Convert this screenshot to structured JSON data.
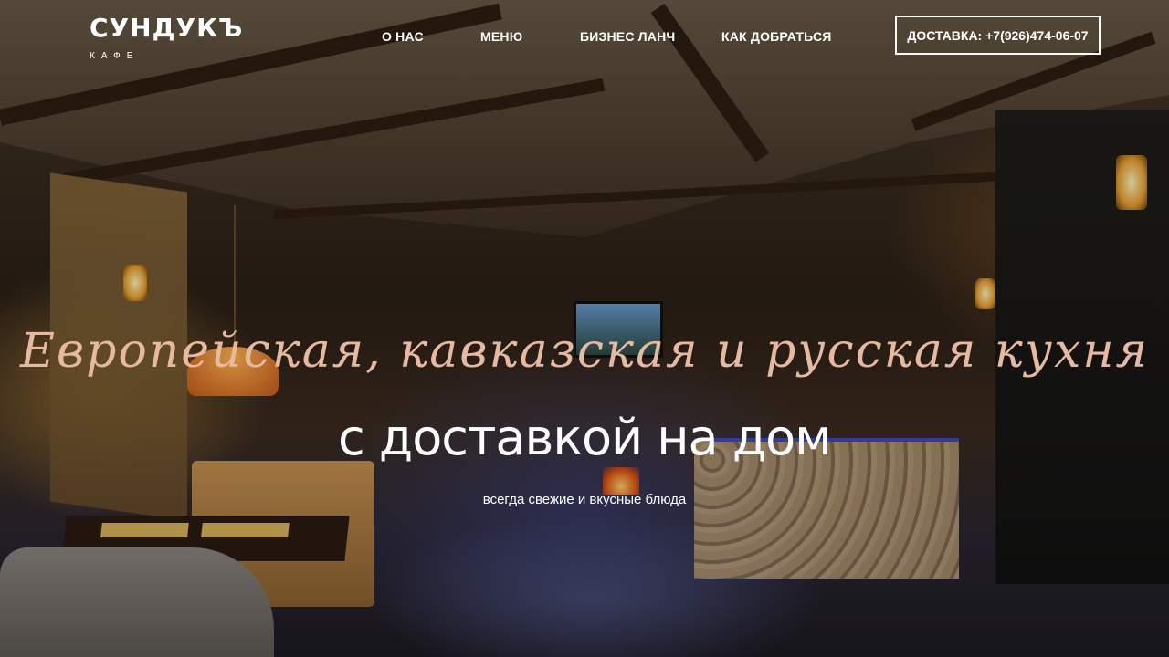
{
  "header": {
    "logo": {
      "name": "СУНДУКЪ",
      "subtitle": "КАФЕ"
    },
    "nav": [
      {
        "label": "О НАС"
      },
      {
        "label": "МЕНЮ"
      },
      {
        "label": "БИЗНЕС ЛАНЧ"
      },
      {
        "label": "КАК ДОБРАТЬСЯ"
      }
    ],
    "delivery_button": "ДОСТАВКА: +7(926)474-06-07"
  },
  "hero": {
    "script_line": "Европейская, кавказская и русская кухня",
    "title": "с доставкой на дом",
    "subtitle": "всегда свежие и вкусные блюда"
  },
  "colors": {
    "script_text": "#e6b9a0",
    "text": "#ffffff"
  }
}
